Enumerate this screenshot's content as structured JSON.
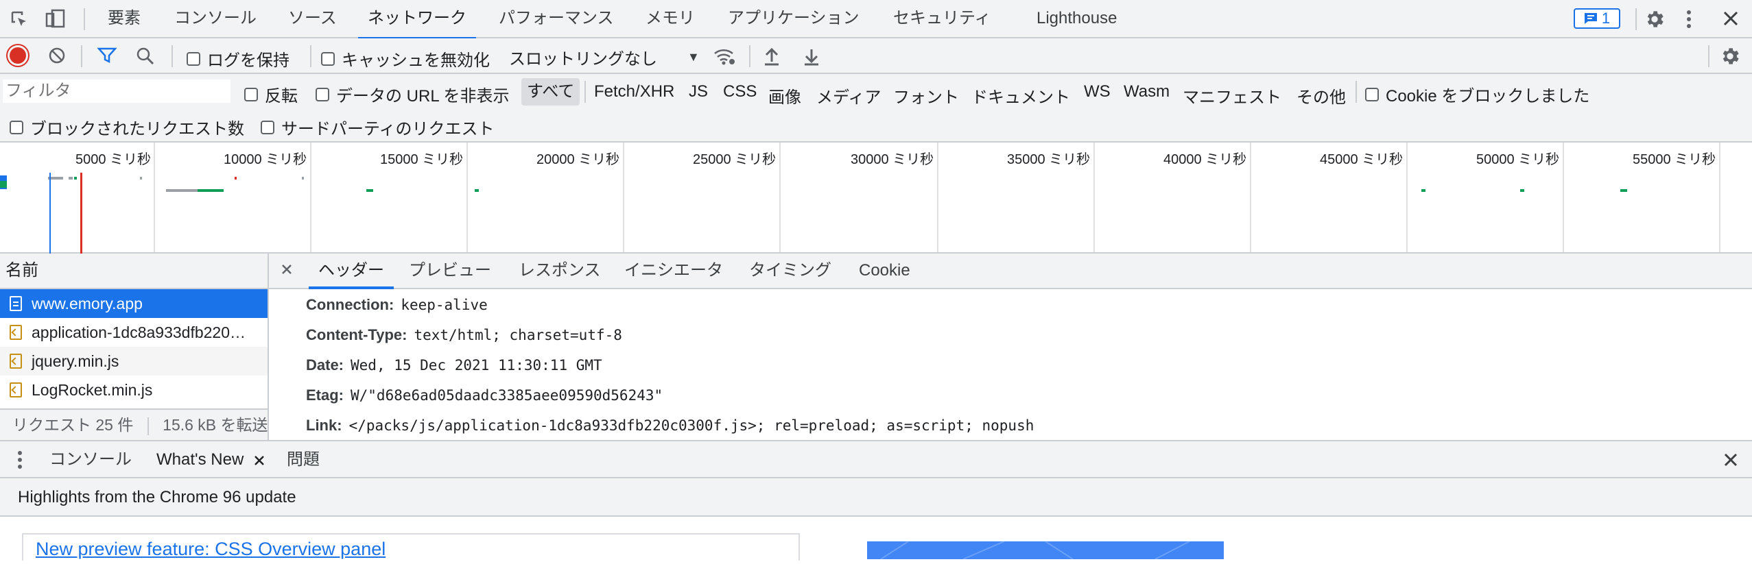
{
  "top_tabs": [
    "要素",
    "コンソール",
    "ソース",
    "ネットワーク",
    "パフォーマンス",
    "メモリ",
    "アプリケーション",
    "セキュリティ",
    "Lighthouse"
  ],
  "active_tab_index": 3,
  "issues_badge": "1",
  "toolbar": {
    "preserve_log": "ログを保持",
    "disable_cache": "キャッシュを無効化",
    "throttling": "スロットリングなし"
  },
  "filter": {
    "placeholder": "フィルタ",
    "invert": "反転",
    "hide_data_urls": "データの URL を非表示",
    "types": [
      "すべて",
      "Fetch/XHR",
      "JS",
      "CSS",
      "画像",
      "メディア",
      "フォント",
      "ドキュメント",
      "WS",
      "Wasm",
      "マニフェスト",
      "その他"
    ],
    "blocked_cookies": "Cookie をブロックしました",
    "blocked_requests": "ブロックされたリクエスト数",
    "third_party": "サードパーティのリクエスト"
  },
  "timeline_labels": [
    "5000 ミリ秒",
    "10000 ミリ秒",
    "15000 ミリ秒",
    "20000 ミリ秒",
    "25000 ミリ秒",
    "30000 ミリ秒",
    "35000 ミリ秒",
    "40000 ミリ秒",
    "45000 ミリ秒",
    "50000 ミリ秒",
    "55000 ミリ秒"
  ],
  "requests": {
    "header": "名前",
    "items": [
      "www.emory.app",
      "application-1dc8a933dfb220…",
      "jquery.min.js",
      "LogRocket.min.js"
    ],
    "footer_count": "リクエスト 25 件",
    "footer_size": "15.6 kB を転送"
  },
  "detail_tabs": [
    "ヘッダー",
    "プレビュー",
    "レスポンス",
    "イニシエータ",
    "タイミング",
    "Cookie"
  ],
  "headers": [
    {
      "name": "Connection:",
      "value": "keep-alive"
    },
    {
      "name": "Content-Type:",
      "value": "text/html; charset=utf-8"
    },
    {
      "name": "Date:",
      "value": "Wed, 15 Dec 2021 11:30:11 GMT"
    },
    {
      "name": "Etag:",
      "value": "W/\"d68e6ad05daadc3385aee09590d56243\""
    },
    {
      "name": "Link:",
      "value": "</packs/js/application-1dc8a933dfb220c0300f.js>; rel=preload; as=script; nopush"
    }
  ],
  "drawer_tabs": [
    "コンソール",
    "What's New",
    "問題"
  ],
  "whats_new_title": "Highlights from the Chrome 96 update",
  "article_link": "New preview feature: CSS Overview panel",
  "colors": {
    "accent": "#1a73e8",
    "record": "#d93025",
    "bar_bg": "#f1f3f4"
  }
}
